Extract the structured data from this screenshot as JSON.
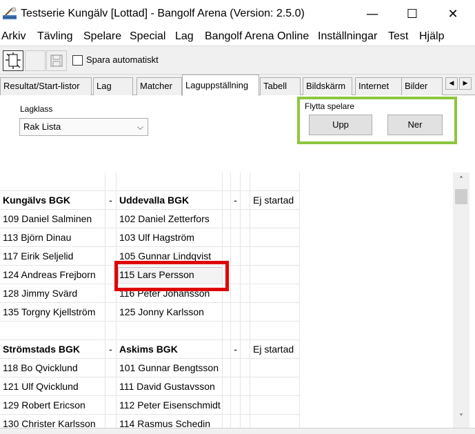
{
  "window": {
    "title": "Testserie Kungälv [Lottad] - Bangolf Arena (Version: 2.5.0)",
    "minimize": "—",
    "maximize": "☐",
    "close": "✕"
  },
  "menu": [
    "Arkiv",
    "Tävling",
    "Spelare",
    "Special",
    "Lag",
    "Bangolf Arena Online",
    "Inställningar",
    "Test",
    "Hjälp"
  ],
  "toolbar": {
    "autosave_label": "Spara automatiskt",
    "autosave_checked": false
  },
  "tabs": [
    "Resultat/Start-listor",
    "Lag",
    "Matcher",
    "Laguppställning",
    "Tabell",
    "Bildskärm",
    "Internet",
    "Bilder"
  ],
  "active_tab": "Laguppställning",
  "tab_scroll": {
    "left": "◀",
    "right": "▶"
  },
  "lagklass": {
    "label": "Lagklass",
    "value": "Rak Lista",
    "chevron": "⌵"
  },
  "move_players": {
    "title": "Flytta spelare",
    "up": "Upp",
    "down": "Ner"
  },
  "matches": [
    {
      "home_team": "Kungälvs BGK",
      "away_team": "Uddevalla BGK",
      "separator": "-",
      "status": "Ej startad",
      "home_players": [
        "109 Daniel Salminen",
        "113 Björn Dinau",
        "117 Eirik Seljelid",
        "124 Andreas Frejborn",
        "128 Jimmy Svärd",
        "135 Torgny Kjellström"
      ],
      "away_players": [
        "102 Daniel Zetterfors",
        "103 Ulf Hagström",
        "105 Gunnar Lindqvist",
        "115 Lars Persson",
        "116 Peter Johansson",
        "125 Jonny Karlsson"
      ]
    },
    {
      "home_team": "Strömstads BGK",
      "away_team": "Askims BGK",
      "separator": "-",
      "status": "Ej startad",
      "home_players": [
        "118 Bo Qvicklund",
        "121 Ulf Qvicklund",
        "129 Robert Ericson",
        "130 Christer Karlsson"
      ],
      "away_players": [
        "101 Gunnar Bengtsson",
        "111 David Gustavsson",
        "112 Peter Eisenschmidt",
        "114 Rasmus Schedin"
      ]
    }
  ],
  "selected_player": "115 Lars Persson",
  "scrollbar": {
    "up": "˄",
    "down": "˅"
  },
  "colors": {
    "highlight_green": "#8cc63f",
    "highlight_red": "#e00000"
  }
}
